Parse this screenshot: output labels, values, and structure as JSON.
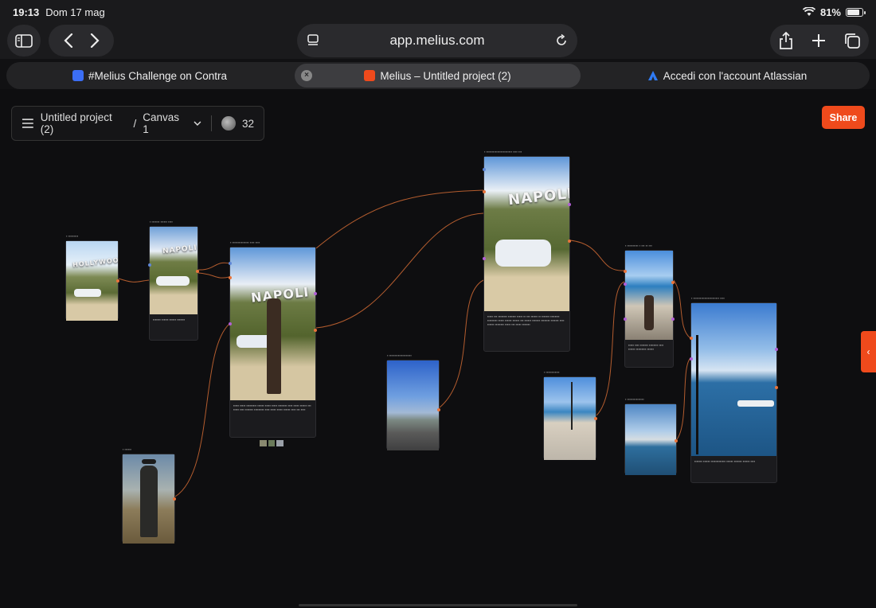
{
  "status": {
    "time": "19:13",
    "date": "Dom 17 mag",
    "battery": "81%",
    "battery_level": 0.81
  },
  "browser": {
    "url": "app.melius.com",
    "tabs": [
      {
        "label": "#Melius Challenge on Contra",
        "active": false,
        "icon": "contra-favicon"
      },
      {
        "label": "Melius – Untitled project (2)",
        "active": true,
        "icon": "melius-favicon"
      },
      {
        "label": "Accedi con l'account Atlassian",
        "active": false,
        "icon": "atlassian-favicon"
      }
    ]
  },
  "project": {
    "name": "Untitled project (2)",
    "separator": "/",
    "canvas": "Canvas 1",
    "count": "32"
  },
  "share_label": "Share",
  "colors": {
    "accent": "#ef4a1c",
    "wire": "#d06a34",
    "canvas_bg": "#0e0e10"
  },
  "nodes": {
    "hollywood": {
      "overlay": "HOLLYWOOD"
    },
    "car_napoli": {
      "overlay": "NAPOLI"
    },
    "man_napoli": {
      "overlay": "NAPOLI"
    },
    "big_napoli": {
      "overlay": "NAPOLI"
    }
  }
}
